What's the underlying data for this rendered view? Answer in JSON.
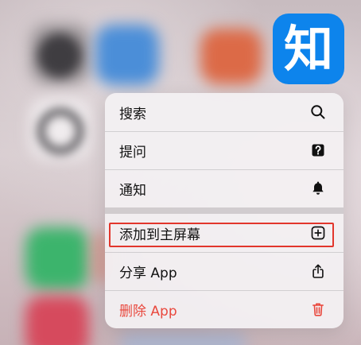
{
  "app_icon": {
    "glyph": "知",
    "icon": "zhihu-app-icon",
    "color": "#0d84ec"
  },
  "menu": {
    "sections": [
      {
        "items": [
          {
            "label": "搜索",
            "icon": "search-icon"
          },
          {
            "label": "提问",
            "icon": "question-icon"
          },
          {
            "label": "通知",
            "icon": "bell-icon"
          }
        ]
      },
      {
        "items": [
          {
            "label": "添加到主屏幕",
            "icon": "add-square-icon",
            "highlighted": true
          },
          {
            "label": "分享 App",
            "icon": "share-icon"
          },
          {
            "label": "删除 App",
            "icon": "trash-icon",
            "destructive": true
          }
        ]
      }
    ]
  },
  "colors": {
    "text": "#111111",
    "destructive": "#e9483d",
    "highlight": "#e2362c",
    "menu_background": "#f2eff1"
  }
}
